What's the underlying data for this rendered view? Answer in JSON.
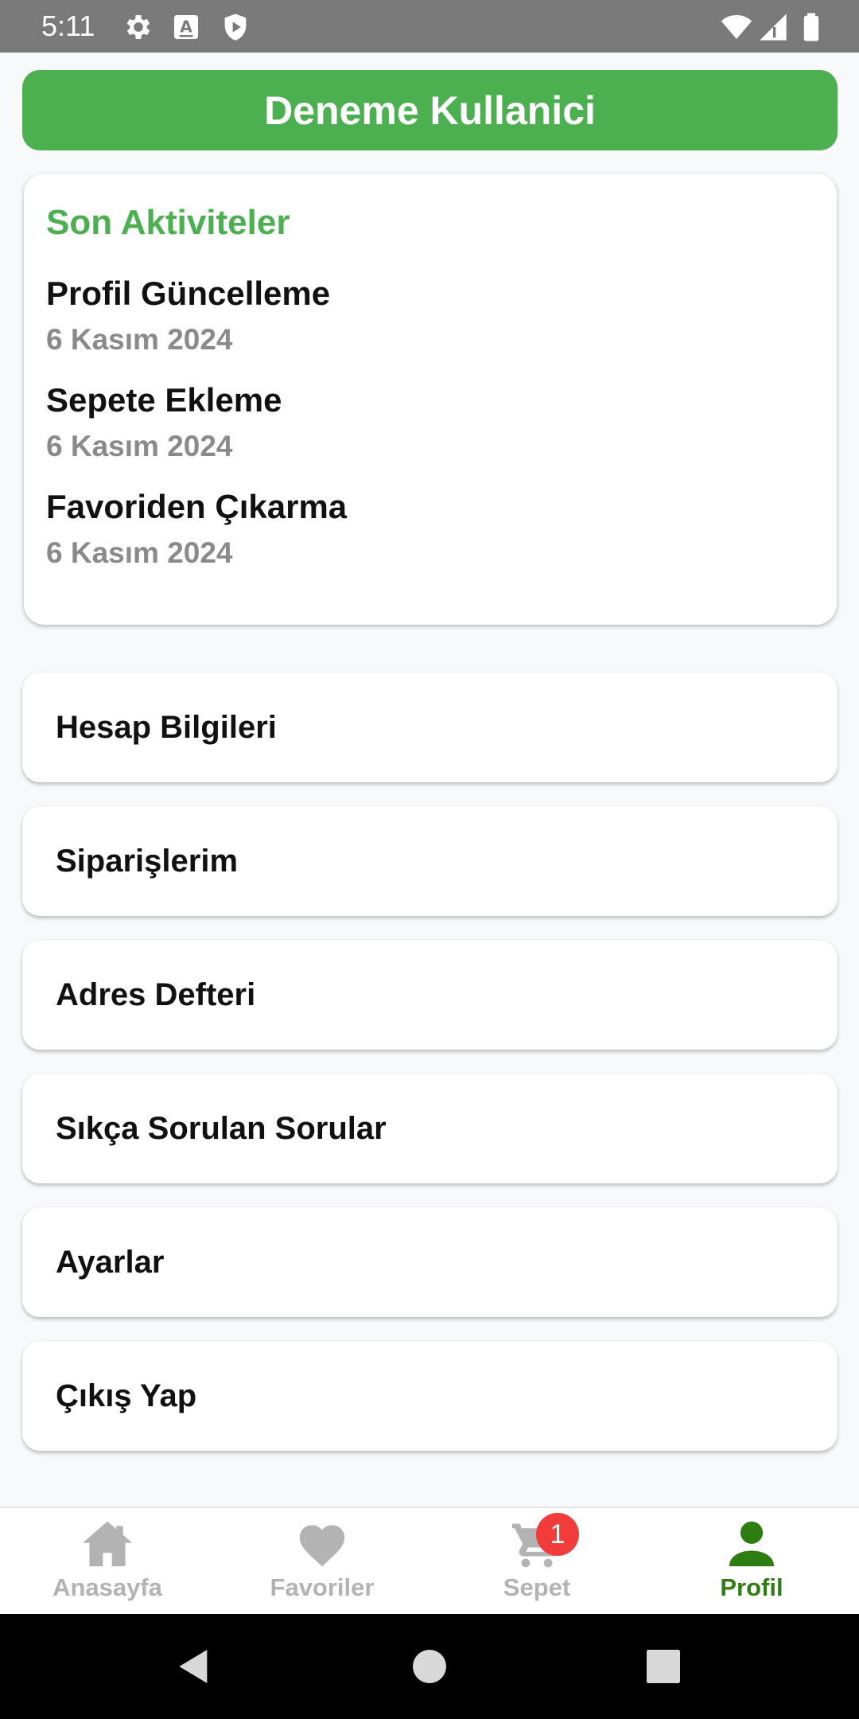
{
  "status_bar": {
    "time": "5:11",
    "icons": [
      "gear-icon",
      "keyboard-a-icon",
      "shield-icon",
      "wifi-icon",
      "signal-icon",
      "battery-icon"
    ]
  },
  "header": {
    "title": "Deneme Kullanici"
  },
  "activity": {
    "title": "Son Aktiviteler",
    "items": [
      {
        "name": "Profil Güncelleme",
        "date": "6 Kasım 2024"
      },
      {
        "name": "Sepete Ekleme",
        "date": "6 Kasım 2024"
      },
      {
        "name": "Favoriden Çıkarma",
        "date": "6 Kasım 2024"
      }
    ]
  },
  "menu": {
    "items": [
      {
        "label": "Hesap Bilgileri"
      },
      {
        "label": "Siparişlerim"
      },
      {
        "label": "Adres Defteri"
      },
      {
        "label": "Sıkça Sorulan Sorular"
      },
      {
        "label": "Ayarlar"
      },
      {
        "label": "Çıkış Yap"
      }
    ]
  },
  "bottom_nav": {
    "items": [
      {
        "label": "Anasayfa",
        "icon": "home-icon"
      },
      {
        "label": "Favoriler",
        "icon": "heart-icon"
      },
      {
        "label": "Sepet",
        "icon": "cart-icon",
        "badge": "1"
      },
      {
        "label": "Profil",
        "icon": "person-icon"
      }
    ],
    "active": "Profil"
  },
  "colors": {
    "primary_green": "#4caf50",
    "active_nav": "#2e7d12",
    "inactive_nav": "#b3b3b3",
    "badge": "#f23b3b",
    "status_bar": "#7a7a7a"
  }
}
